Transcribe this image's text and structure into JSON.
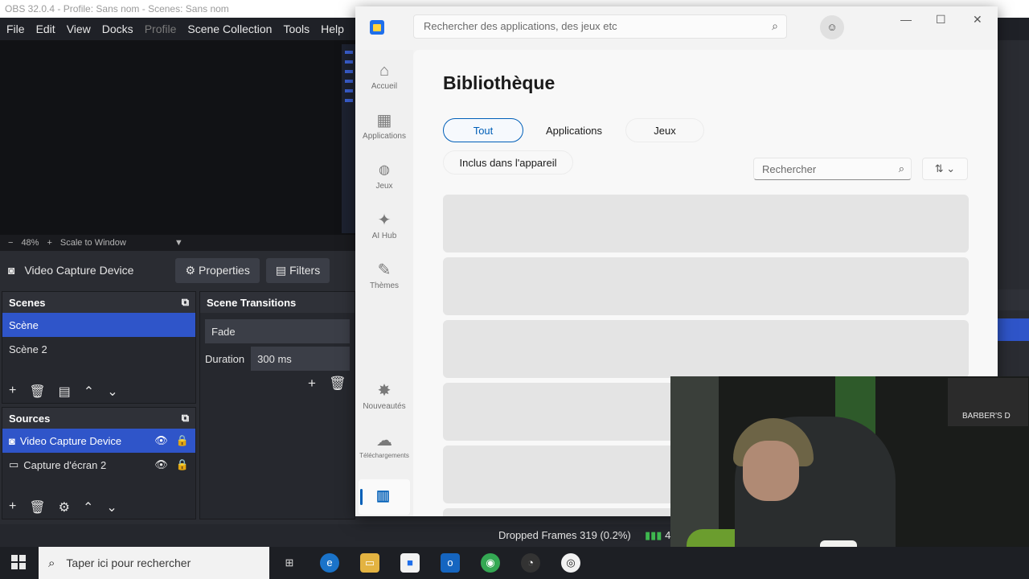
{
  "obs": {
    "title": "OBS 32.0.4 - Profile: Sans nom - Scenes: Sans nom",
    "menu": [
      "File",
      "Edit",
      "View",
      "Docks",
      "Profile",
      "Scene Collection",
      "Tools",
      "Help"
    ],
    "zoom": {
      "minus": "−",
      "value": "48%",
      "plus": "+",
      "mode": "Scale to Window"
    },
    "source_bar": {
      "label": "Video Capture Device",
      "properties": "Properties",
      "filters": "Filters"
    },
    "scenes": {
      "title": "Scenes",
      "items": [
        "Scène",
        "Scène 2"
      ]
    },
    "transitions": {
      "title": "Scene Transitions",
      "type": "Fade",
      "duration_label": "Duration",
      "duration_value": "300 ms"
    },
    "sources": {
      "title": "Sources",
      "items": [
        "Video Capture Device",
        "Capture d'écran 2"
      ]
    },
    "status": {
      "dropped": "Dropped Frames 319 (0.2%)",
      "fps_partial": "4"
    }
  },
  "store": {
    "search_placeholder": "Rechercher des applications, des jeux etc",
    "avatar_icon": "user-icon",
    "nav": [
      {
        "label": "Accueil",
        "icon": "home-icon",
        "glyph": "⌂"
      },
      {
        "label": "Applications",
        "icon": "apps-icon",
        "glyph": "▦"
      },
      {
        "label": "Jeux",
        "icon": "gamepad-icon",
        "glyph": "🎮"
      },
      {
        "label": "AI Hub",
        "icon": "ai-hub-icon",
        "glyph": "✦"
      },
      {
        "label": "Thèmes",
        "icon": "brush-icon",
        "glyph": "✎"
      },
      {
        "label": "Nouveautés",
        "icon": "news-icon",
        "glyph": "✸"
      },
      {
        "label": "Téléchargements",
        "icon": "download-icon",
        "glyph": "☁"
      }
    ],
    "heading": "Bibliothèque",
    "filters": [
      "Tout",
      "Applications",
      "Jeux",
      "Inclus dans l'appareil"
    ],
    "lib_search_placeholder": "Rechercher",
    "sort_label": "⇅ ⌄"
  },
  "webcam": {
    "sign_text": "BARBER'S D"
  },
  "taskbar": {
    "search_placeholder": "Taper ici pour rechercher"
  }
}
